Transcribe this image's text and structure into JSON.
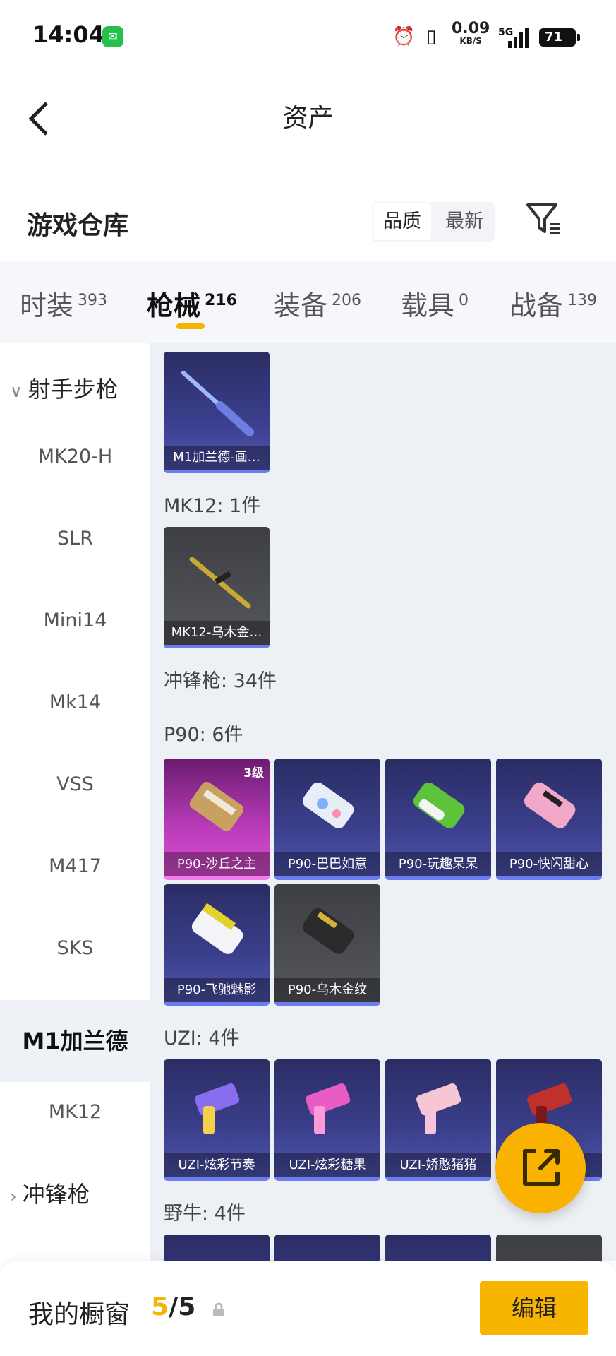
{
  "status_bar": {
    "time": "14:04",
    "net_speed_value": "0.09",
    "net_speed_unit": "KB/S",
    "network": "5G",
    "battery": "71"
  },
  "header": {
    "title": "资产"
  },
  "warehouse": {
    "title": "游戏仓库",
    "sort_options": [
      "品质",
      "最新"
    ],
    "sort_selected": "品质"
  },
  "tabs": [
    {
      "label": "时装",
      "count": "393"
    },
    {
      "label": "枪械",
      "count": "216"
    },
    {
      "label": "装备",
      "count": "206"
    },
    {
      "label": "载具",
      "count": "0"
    },
    {
      "label": "战备",
      "count": "139"
    }
  ],
  "active_tab": "枪械",
  "sidebar": {
    "group_1": "射手步枪",
    "items": [
      "MK20-H",
      "SLR",
      "Mini14",
      "Mk14",
      "VSS",
      "M417",
      "SKS",
      "M1加兰德",
      "MK12"
    ],
    "active_item": "M1加兰德",
    "group_2": "冲锋枪"
  },
  "content": {
    "m1_cards": [
      "M1加兰德-画…"
    ],
    "mk12_label": "MK12: 1件",
    "mk12_cards": [
      "MK12-乌木金…"
    ],
    "smg_label": "冲锋枪: 34件",
    "p90_label": "P90: 6件",
    "p90_cards": [
      "P90-沙丘之主",
      "P90-巴巴如意",
      "P90-玩趣呆呆",
      "P90-快闪甜心",
      "P90-飞驰魅影",
      "P90-乌木金纹"
    ],
    "p90_first_level": "3级",
    "uzi_label": "UZI: 4件",
    "uzi_cards": [
      "UZI-炫彩节奏",
      "UZI-炫彩糖果",
      "UZI-娇憨猪猪",
      "…"
    ],
    "bison_label": "野牛: 4件"
  },
  "bottom": {
    "showcase_label": "我的橱窗",
    "current": "5",
    "separator": "/",
    "total": "5",
    "edit_label": "编辑"
  },
  "colors": {
    "accent": "#f5b400",
    "purple_card": "#3b3f8c",
    "pink_card": "#b53ab6"
  }
}
